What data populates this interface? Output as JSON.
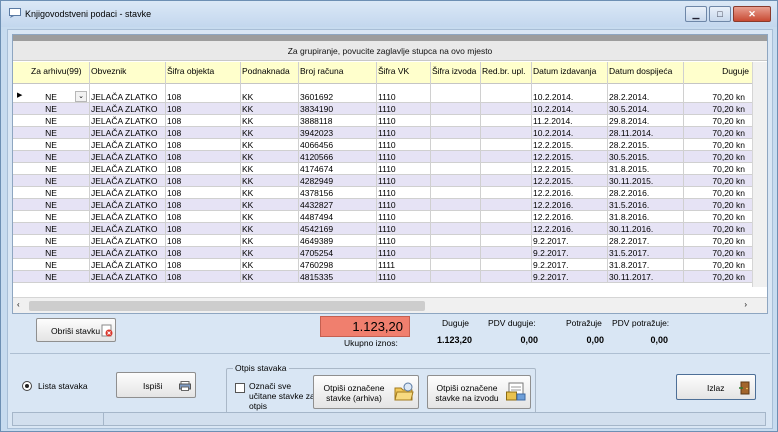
{
  "window": {
    "title": "Knjigovodstveni podaci - stavke"
  },
  "grid": {
    "group_hint": "Za grupiranje, povucite zaglavlje stupca na ovo mjesto",
    "columns": [
      "Za arhivu(99)",
      "Obveznik",
      "Šifra objekta",
      "Podnaknada",
      "Broj računa",
      "Šifra VK",
      "Šifra izvoda",
      "Red.br. upl.",
      "Datum izdavanja",
      "Datum dospijeća",
      "Duguje"
    ],
    "rows": [
      [
        "NE",
        "JELAČA ZLATKO",
        "108",
        "KK",
        "3601692",
        "1110",
        "",
        "",
        "10.2.2014.",
        "28.2.2014.",
        "70,20 kn"
      ],
      [
        "NE",
        "JELAČA ZLATKO",
        "108",
        "KK",
        "3834190",
        "1110",
        "",
        "",
        "10.2.2014.",
        "30.5.2014.",
        "70,20 kn"
      ],
      [
        "NE",
        "JELAČA ZLATKO",
        "108",
        "KK",
        "3888118",
        "1110",
        "",
        "",
        "11.2.2014.",
        "29.8.2014.",
        "70,20 kn"
      ],
      [
        "NE",
        "JELAČA ZLATKO",
        "108",
        "KK",
        "3942023",
        "1110",
        "",
        "",
        "10.2.2014.",
        "28.11.2014.",
        "70,20 kn"
      ],
      [
        "NE",
        "JELAČA ZLATKO",
        "108",
        "KK",
        "4066456",
        "1110",
        "",
        "",
        "12.2.2015.",
        "28.2.2015.",
        "70,20 kn"
      ],
      [
        "NE",
        "JELAČA ZLATKO",
        "108",
        "KK",
        "4120566",
        "1110",
        "",
        "",
        "12.2.2015.",
        "30.5.2015.",
        "70,20 kn"
      ],
      [
        "NE",
        "JELAČA ZLATKO",
        "108",
        "KK",
        "4174674",
        "1110",
        "",
        "",
        "12.2.2015.",
        "31.8.2015.",
        "70,20 kn"
      ],
      [
        "NE",
        "JELAČA ZLATKO",
        "108",
        "KK",
        "4282949",
        "1110",
        "",
        "",
        "12.2.2015.",
        "30.11.2015.",
        "70,20 kn"
      ],
      [
        "NE",
        "JELAČA ZLATKO",
        "108",
        "KK",
        "4378156",
        "1110",
        "",
        "",
        "12.2.2016.",
        "28.2.2016.",
        "70,20 kn"
      ],
      [
        "NE",
        "JELAČA ZLATKO",
        "108",
        "KK",
        "4432827",
        "1110",
        "",
        "",
        "12.2.2016.",
        "31.5.2016.",
        "70,20 kn"
      ],
      [
        "NE",
        "JELAČA ZLATKO",
        "108",
        "KK",
        "4487494",
        "1110",
        "",
        "",
        "12.2.2016.",
        "31.8.2016.",
        "70,20 kn"
      ],
      [
        "NE",
        "JELAČA ZLATKO",
        "108",
        "KK",
        "4542169",
        "1110",
        "",
        "",
        "12.2.2016.",
        "30.11.2016.",
        "70,20 kn"
      ],
      [
        "NE",
        "JELAČA ZLATKO",
        "108",
        "KK",
        "4649389",
        "1110",
        "",
        "",
        "9.2.2017.",
        "28.2.2017.",
        "70,20 kn"
      ],
      [
        "NE",
        "JELAČA ZLATKO",
        "108",
        "KK",
        "4705254",
        "1110",
        "",
        "",
        "9.2.2017.",
        "31.5.2017.",
        "70,20 kn"
      ],
      [
        "NE",
        "JELAČA ZLATKO",
        "108",
        "KK",
        "4760298",
        "1111",
        "",
        "",
        "9.2.2017.",
        "31.8.2017.",
        "70,20 kn"
      ],
      [
        "NE",
        "JELAČA ZLATKO",
        "108",
        "KK",
        "4815335",
        "1110",
        "",
        "",
        "9.2.2017.",
        "30.11.2017.",
        "70,20 kn"
      ]
    ]
  },
  "buttons": {
    "delete": "Obriši stavku",
    "print": "Ispiši",
    "writeoff_archive": "Otpiši označene stavke (arhiva)",
    "writeoff_statement": "Otpiši označene stavke na izvodu",
    "exit": "Izlaz"
  },
  "totals": {
    "amount": "1.123,20",
    "label": "Ukupno iznos:",
    "duguje_label": "Duguje",
    "duguje_value": "1.123,20",
    "pdv_duguje_label": "PDV duguje:",
    "pdv_duguje_value": "0,00",
    "potrazuje_label": "Potražuje",
    "potrazuje_value": "0,00",
    "pdv_potrazuje_label": "PDV potražuje:",
    "pdv_potrazuje_value": "0,00"
  },
  "options": {
    "radio_label": "Lista stavaka",
    "group_title": "Otpis stavaka",
    "checkbox_label": "Označi sve učitane stavke za otpis"
  },
  "colors": {
    "total_bg": "#f07f6e",
    "alt_row": "#e6e3f5",
    "header_bg": "#ffffcc"
  },
  "icons": [
    "app-icon",
    "minimize-icon",
    "maximize-icon",
    "close-icon",
    "delete-icon",
    "printer-icon",
    "archive-icon",
    "statement-icon",
    "exit-door-icon"
  ]
}
